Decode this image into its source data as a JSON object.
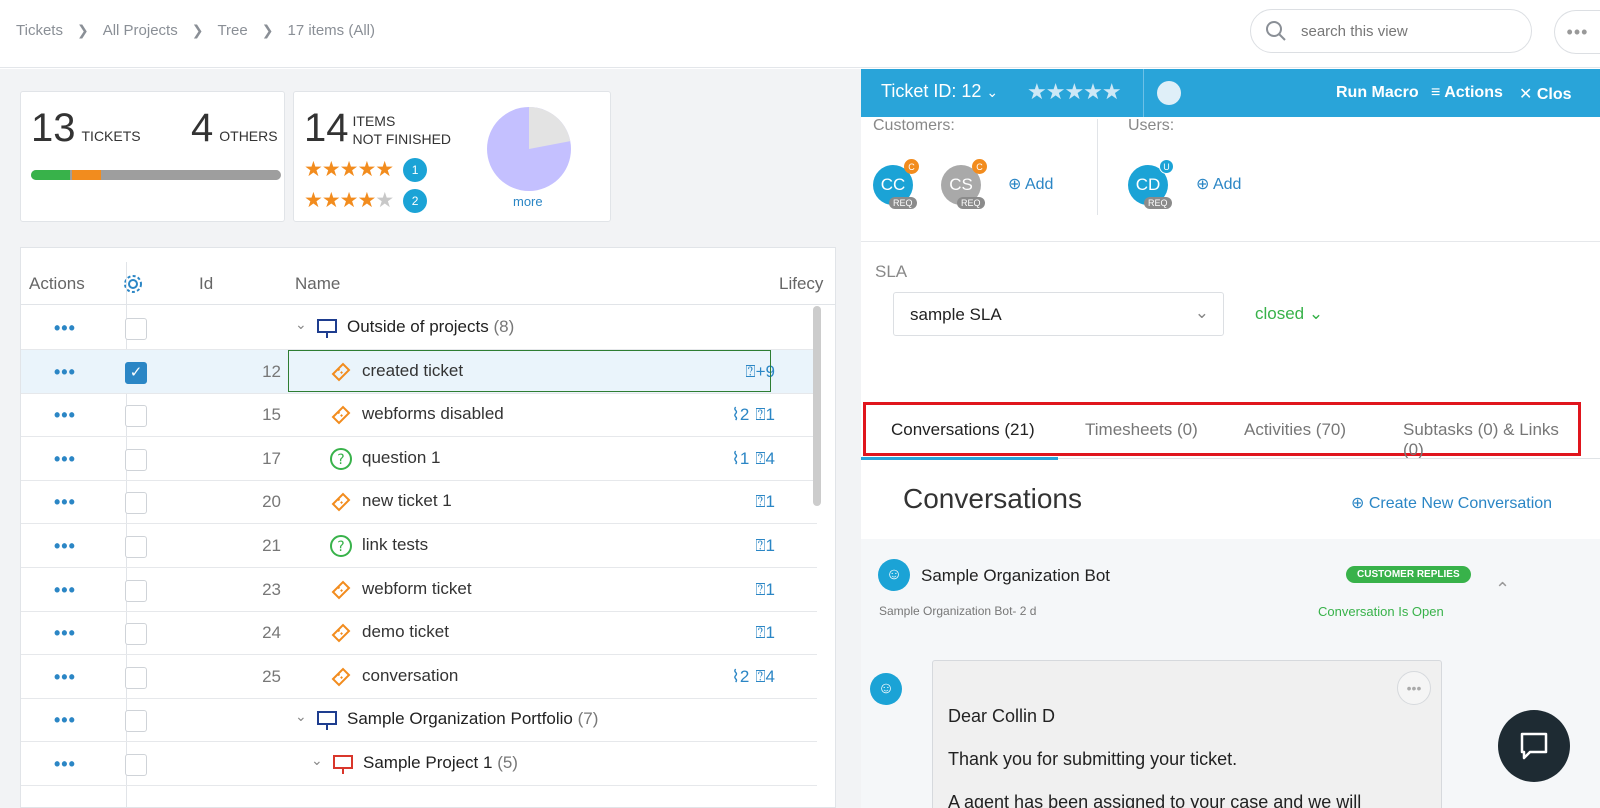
{
  "breadcrumb": [
    "Tickets",
    "All Projects",
    "Tree",
    "17 items (All)"
  ],
  "search": {
    "placeholder": "search this view"
  },
  "summary": {
    "tickets_count": "13",
    "tickets_label": "TICKETS",
    "others_count": "4",
    "others_label": "OTHERS",
    "progress": [
      0.16,
      0.12,
      0.72
    ],
    "items_count": "14",
    "items_label_1": "ITEMS",
    "items_label_2": "NOT FINISHED",
    "rating5_count": "1",
    "rating4_count": "2",
    "pie_more": "more",
    "pie_fraction_done": 0.22
  },
  "grid": {
    "headers": {
      "actions": "Actions",
      "id": "Id",
      "name": "Name",
      "lifecycle": "Lifecy"
    },
    "rows": [
      {
        "type": "group",
        "name": "Outside of projects",
        "count": "(8)"
      },
      {
        "id": "12",
        "name": "created ticket",
        "meta": "+9",
        "selected": true
      },
      {
        "id": "15",
        "name": "webforms disabled",
        "links": "2",
        "convs": "1"
      },
      {
        "id": "17",
        "name": "question 1",
        "links": "1",
        "convs": "4",
        "kind": "question"
      },
      {
        "id": "20",
        "name": "new ticket 1",
        "convs": "1"
      },
      {
        "id": "21",
        "name": "link tests",
        "convs": "1",
        "kind": "question"
      },
      {
        "id": "23",
        "name": "webform ticket",
        "convs": "1"
      },
      {
        "id": "24",
        "name": "demo ticket",
        "convs": "1"
      },
      {
        "id": "25",
        "name": "conversation",
        "links": "2",
        "convs": "4"
      },
      {
        "type": "group",
        "name": "Sample Organization  Portfolio",
        "count": "(7)"
      },
      {
        "type": "group",
        "name": "Sample Project 1",
        "count": "(5)"
      }
    ]
  },
  "ticket": {
    "title": "Ticket ID: 12",
    "run_macro": "Run Macro",
    "actions": "Actions",
    "close": "Clos",
    "customers_label": "Customers:",
    "users_label": "Users:",
    "customers": [
      {
        "initials": "CC",
        "badge": "C",
        "role": "REQ"
      },
      {
        "initials": "CS",
        "badge": "C",
        "role": "REQ"
      }
    ],
    "users": [
      {
        "initials": "CD",
        "badge": "U",
        "role": "REQ"
      }
    ],
    "add_label": "Add",
    "sla_label": "SLA",
    "sla_value": "sample SLA",
    "status": "closed"
  },
  "tabs": [
    "Conversations (21)",
    "Timesheets (0)",
    "Activities (70)",
    "Subtasks (0) & Links (0)"
  ],
  "conversations": {
    "heading": "Conversations",
    "new_button": "Create New Conversation",
    "sender": "Sample Organization Bot",
    "sub": "Sample Organization Bot- 2 d",
    "badge": "CUSTOMER REPLIES",
    "state": "Conversation Is Open",
    "line1": "Dear Collin D",
    "line2": "Thank you for submitting your ticket.",
    "line3": "A agent has been assigned to your case and we will"
  },
  "colors": {
    "accent": "#29a4d9",
    "link": "#2b86c5",
    "green": "#38b24a",
    "orange": "#f28c1e",
    "highlight": "#e0151d"
  }
}
